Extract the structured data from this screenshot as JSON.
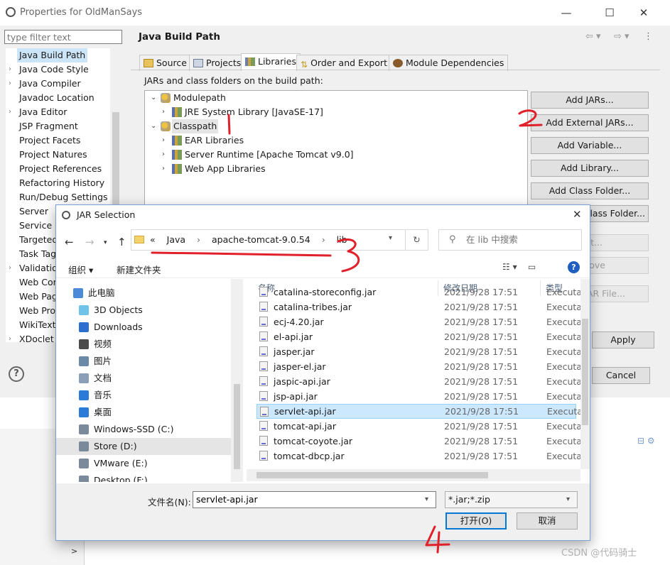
{
  "window": {
    "title": "Properties for OldManSays",
    "controls": {
      "minimize": "—",
      "maximize": "☐",
      "close": "✕"
    }
  },
  "filter": {
    "placeholder": "type filter text"
  },
  "sidebar": {
    "items": [
      {
        "label": "Java Build Path",
        "expandable": false,
        "selected": true
      },
      {
        "label": "Java Code Style",
        "expandable": true
      },
      {
        "label": "Java Compiler",
        "expandable": true
      },
      {
        "label": "Javadoc Location",
        "expandable": false
      },
      {
        "label": "Java Editor",
        "expandable": true
      },
      {
        "label": "JSP Fragment",
        "expandable": false
      },
      {
        "label": "Project Facets",
        "expandable": false
      },
      {
        "label": "Project Natures",
        "expandable": false
      },
      {
        "label": "Project References",
        "expandable": false
      },
      {
        "label": "Refactoring History",
        "expandable": false
      },
      {
        "label": "Run/Debug Settings",
        "expandable": false
      },
      {
        "label": "Server",
        "expandable": false
      },
      {
        "label": "Service P",
        "expandable": false
      },
      {
        "label": "Targeted",
        "expandable": false
      },
      {
        "label": "Task Tag",
        "expandable": false
      },
      {
        "label": "Validatio",
        "expandable": true
      },
      {
        "label": "Web Cor",
        "expandable": false
      },
      {
        "label": "Web Pag",
        "expandable": false
      },
      {
        "label": "Web Pro",
        "expandable": false
      },
      {
        "label": "WikiText",
        "expandable": false
      },
      {
        "label": "XDoclet",
        "expandable": true
      }
    ]
  },
  "panel": {
    "title": "Java Build Path",
    "tabs": [
      "Source",
      "Projects",
      "Libraries",
      "Order and Export",
      "Module Dependencies"
    ],
    "active_tab": "Libraries",
    "section_label": "JARs and class folders on the build path:",
    "tree": [
      {
        "label": "Modulepath",
        "level": 0,
        "expanded": true
      },
      {
        "label": "JRE System Library [JavaSE-17]",
        "level": 1,
        "expanded": false
      },
      {
        "label": "Classpath",
        "level": 0,
        "expanded": true,
        "selected": true
      },
      {
        "label": "EAR Libraries",
        "level": 1,
        "expanded": false
      },
      {
        "label": "Server Runtime [Apache Tomcat v9.0]",
        "level": 1,
        "expanded": false
      },
      {
        "label": "Web App Libraries",
        "level": 1,
        "expanded": false
      }
    ],
    "buttons": {
      "add_jars": "Add JARs...",
      "add_external_jars": "Add External JARs...",
      "add_variable": "Add Variable...",
      "add_library": "Add Library...",
      "add_class_folder": "Add Class Folder...",
      "add_external_class_folder_partial": "Class Folder...",
      "edit_partial": "t...",
      "remove_partial": "ove",
      "migrate_partial": "JAR File...",
      "apply": "Apply",
      "cancel": "Cancel"
    }
  },
  "dialog": {
    "title": "JAR Selection",
    "close": "✕",
    "address": {
      "prefix": "«",
      "crumbs": [
        "Java",
        "apache-tomcat-9.0.54",
        "lib"
      ]
    },
    "search_placeholder": "在 lib 中搜索",
    "toolbar": {
      "organize": "组织 ▾",
      "new_folder": "新建文件夹"
    },
    "nav": [
      {
        "label": "此电脑",
        "icon": "computer-icon",
        "indent": 1
      },
      {
        "label": "3D Objects",
        "icon": "cube-icon",
        "indent": 2
      },
      {
        "label": "Downloads",
        "icon": "download-icon",
        "indent": 2
      },
      {
        "label": "视频",
        "icon": "video-icon",
        "indent": 2
      },
      {
        "label": "图片",
        "icon": "picture-icon",
        "indent": 2
      },
      {
        "label": "文档",
        "icon": "document-icon",
        "indent": 2
      },
      {
        "label": "音乐",
        "icon": "music-icon",
        "indent": 2
      },
      {
        "label": "桌面",
        "icon": "desktop-icon",
        "indent": 2
      },
      {
        "label": "Windows-SSD (C:)",
        "icon": "drive-icon",
        "indent": 2
      },
      {
        "label": "Store (D:)",
        "icon": "drive-icon",
        "indent": 2,
        "selected": true
      },
      {
        "label": "VMware (E:)",
        "icon": "drive-icon",
        "indent": 2
      },
      {
        "label": "Desktop (F:)",
        "icon": "drive-icon",
        "indent": 2
      }
    ],
    "columns": {
      "name": "名称",
      "date": "修改日期",
      "type": "类型"
    },
    "files": [
      {
        "name": "catalina-storeconfig.jar",
        "date": "2021/9/28 17:51",
        "type": "Executal"
      },
      {
        "name": "catalina-tribes.jar",
        "date": "2021/9/28 17:51",
        "type": "Executal"
      },
      {
        "name": "ecj-4.20.jar",
        "date": "2021/9/28 17:51",
        "type": "Executal"
      },
      {
        "name": "el-api.jar",
        "date": "2021/9/28 17:51",
        "type": "Executal"
      },
      {
        "name": "jasper.jar",
        "date": "2021/9/28 17:51",
        "type": "Executal"
      },
      {
        "name": "jasper-el.jar",
        "date": "2021/9/28 17:51",
        "type": "Executal"
      },
      {
        "name": "jaspic-api.jar",
        "date": "2021/9/28 17:51",
        "type": "Executal"
      },
      {
        "name": "jsp-api.jar",
        "date": "2021/9/28 17:51",
        "type": "Executal"
      },
      {
        "name": "servlet-api.jar",
        "date": "2021/9/28 17:51",
        "type": "Executal",
        "selected": true
      },
      {
        "name": "tomcat-api.jar",
        "date": "2021/9/28 17:51",
        "type": "Executal"
      },
      {
        "name": "tomcat-coyote.jar",
        "date": "2021/9/28 17:51",
        "type": "Executal"
      },
      {
        "name": "tomcat-dbcp.jar",
        "date": "2021/9/28 17:51",
        "type": "Executal"
      }
    ],
    "filename_label": "文件名(N):",
    "filename_value": "servlet-api.jar",
    "filetype_value": "*.jar;*.zip",
    "open_button": "打开(O)",
    "cancel_button": "取消"
  },
  "annotations": {
    "color": "#e0202a",
    "marks": [
      "1",
      "2",
      "3",
      "4"
    ]
  },
  "watermark": "CSDN @代码骑士"
}
